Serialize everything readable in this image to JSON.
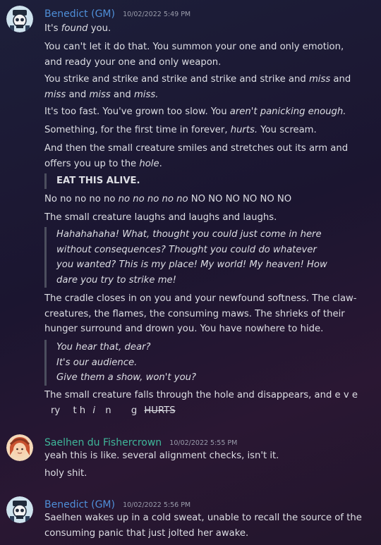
{
  "colors": {
    "gm_name": "#4f8fd8",
    "saelhen_name": "#3fb79a"
  },
  "messages": [
    {
      "author": "Benedict (GM)",
      "timestamp": "10/02/2022 5:49 PM",
      "avatar_icon": "skull-crown-avatar",
      "lines": {
        "l1a": "It's ",
        "l1b": "found",
        "l1c": " you.",
        "l2": "You can't let it do that. You summon your one and only emotion,",
        "l2b": "and ready your one and only weapon.",
        "l3a": "You strike and strike and strike and strike and strike and ",
        "l3b": "miss",
        "l3c": " and",
        "l3d": "miss",
        "l3e": " and ",
        "l3f": "miss",
        "l3g": " and ",
        "l3h": "miss.",
        "l4a": "It's too fast. You've grown too slow. You ",
        "l4b": "aren't panicking enough.",
        "l5a": "Something, for the first time in forever, ",
        "l5b": "hurts.",
        "l5c": " You scream.",
        "l6a": "And then the small creature smiles and stretches out its arm and",
        "l6b": "offers you up to the ",
        "l6c": "hole",
        "l6d": ".",
        "q1": "EAT THIS ALIVE.",
        "l7a": "No no no no no ",
        "l7b": "no no no no no",
        "l7c": " NO NO NO NO NO NO",
        "l8": "The small creature laughs and laughs and laughs.",
        "q2a": "Hahahahaha! What, thought you could just come in here",
        "q2b": "without consequences? Thought you could do whatever",
        "q2c": "you wanted? This is my place! My world! My heaven! How",
        "q2d": "dare you try to strike me!",
        "l9a": "The cradle closes in on you and your newfound softness. The claw-",
        "l9b": "creatures, the flames, the consuming maws. The shrieks of their",
        "l9c": "hunger surround and drown you. You have nowhere to hide.",
        "q3a": "You hear that, dear?",
        "q3b": "It's our audience.",
        "q3c": "Give them a show, won't you?",
        "l10": "The small creature falls through the hole and disappears, and e v e",
        "l11_ry": "ry",
        "l11_th": "t h",
        "l11_i": "i",
        "l11_n": "n",
        "l11_g": "g",
        "l11_hurts": "HURTS"
      }
    },
    {
      "author": "Saelhen du Fishercrown",
      "timestamp": "10/02/2022 5:55 PM",
      "avatar_icon": "red-hair-avatar",
      "lines": {
        "l1": "yeah this is like. several alignment checks, isn't it.",
        "l2": "holy shit."
      }
    },
    {
      "author": "Benedict (GM)",
      "timestamp": "10/02/2022 5:56 PM",
      "avatar_icon": "skull-crown-avatar",
      "lines": {
        "l1": "Saelhen wakes up in a cold sweat, unable to recall the source of the",
        "l2": "consuming panic that just jolted her awake."
      }
    }
  ]
}
